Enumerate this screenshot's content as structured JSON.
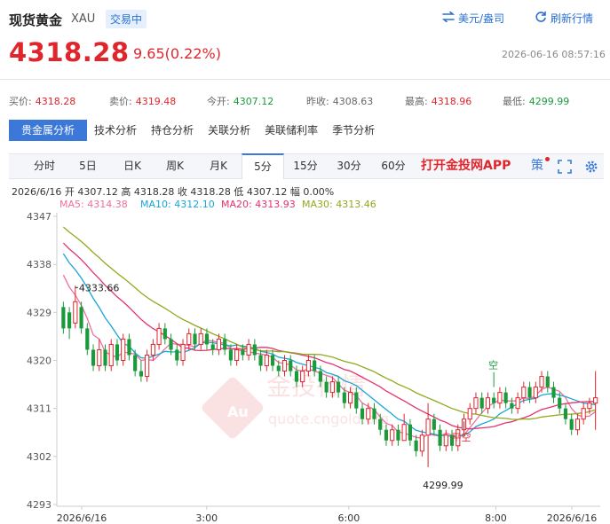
{
  "header": {
    "name": "现货黄金",
    "code": "XAU",
    "status_badge": "交易中",
    "currency_button": "美元/盎司",
    "refresh_button": "刷新行情"
  },
  "price": {
    "last": "4318.28",
    "change": "9.65(0.22%)",
    "datetime": "2026-06-16 08:57:16"
  },
  "quotes": [
    {
      "label": "买价:",
      "value": "4318.28"
    },
    {
      "label": "卖价:",
      "value": "4319.48"
    },
    {
      "label": "今开:",
      "value": "4307.12"
    },
    {
      "label": "昨收:",
      "value": "4308.63"
    },
    {
      "label": "最高:",
      "value": "4318.96"
    },
    {
      "label": "最低:",
      "value": "4299.99"
    }
  ],
  "analysis_tabs": [
    {
      "label": "贵金属分析",
      "active": true
    },
    {
      "label": "技术分析"
    },
    {
      "label": "持仓分析"
    },
    {
      "label": "关联分析"
    },
    {
      "label": "美联储利率"
    },
    {
      "label": "季节分析"
    }
  ],
  "period_tabs": [
    {
      "label": "分时"
    },
    {
      "label": "5日"
    },
    {
      "label": "日K"
    },
    {
      "label": "周K"
    },
    {
      "label": "月K"
    },
    {
      "label": "5分",
      "active": true
    },
    {
      "label": "15分"
    },
    {
      "label": "30分"
    },
    {
      "label": "60分"
    }
  ],
  "app_link": "打开金投网APP",
  "toolbar_icon_text": "策",
  "ohlc_line": "2026/6/16  开 4307.12  高 4318.28  收 4318.28  低 4307.12  幅 0.00%",
  "ma_legend": [
    {
      "label": "MA5: 4314.38",
      "color": "#f06fa0"
    },
    {
      "label": "MA10: 4312.10",
      "color": "#1aa5d6"
    },
    {
      "label": "MA20: 4313.93",
      "color": "#e5336b"
    },
    {
      "label": "MA30: 4313.46",
      "color": "#8faa1e"
    }
  ],
  "watermark": {
    "text": "金投行情",
    "sub": "quote.cngold.org"
  },
  "chart_data": {
    "type": "candlestick",
    "y_ticks": [
      "4347",
      "4338",
      "4329",
      "4320",
      "4311",
      "4302",
      "4293"
    ],
    "ylim": [
      4293,
      4347
    ],
    "x_ticks": [
      "2026/6/16",
      "3:00",
      "6:00",
      "8:00",
      "2026/6/16"
    ],
    "annotations": {
      "high": "4333.66",
      "low": "4299.99",
      "open_marker": "空",
      "close_marker": "平空"
    },
    "colors": {
      "up": "#e0262d",
      "down": "#1b9a3c"
    },
    "candles": [
      [
        4330,
        4326,
        4331,
        4325
      ],
      [
        4329,
        4326,
        4330,
        4324
      ],
      [
        4327,
        4331,
        4334,
        4326
      ],
      [
        4330,
        4326,
        4331,
        4325
      ],
      [
        4326,
        4322,
        4327,
        4321
      ],
      [
        4322,
        4319,
        4323,
        4318
      ],
      [
        4319,
        4322,
        4324,
        4318
      ],
      [
        4322,
        4319,
        4323,
        4318
      ],
      [
        4319,
        4323,
        4324,
        4318
      ],
      [
        4323,
        4320,
        4324,
        4319
      ],
      [
        4320,
        4324,
        4325,
        4319
      ],
      [
        4324,
        4321,
        4325,
        4320
      ],
      [
        4321,
        4318,
        4322,
        4317
      ],
      [
        4318,
        4317,
        4320,
        4316
      ],
      [
        4317,
        4321,
        4322,
        4316
      ],
      [
        4321,
        4323,
        4324,
        4320
      ],
      [
        4323,
        4326,
        4327,
        4322
      ],
      [
        4326,
        4324,
        4327,
        4323
      ],
      [
        4324,
        4322,
        4325,
        4321
      ],
      [
        4322,
        4320,
        4323,
        4319
      ],
      [
        4320,
        4323,
        4324,
        4319
      ],
      [
        4323,
        4325,
        4326,
        4322
      ],
      [
        4325,
        4323,
        4326,
        4322
      ],
      [
        4323,
        4325,
        4326,
        4322
      ],
      [
        4325,
        4323,
        4326,
        4322
      ],
      [
        4323,
        4322,
        4324,
        4321
      ],
      [
        4322,
        4324,
        4325,
        4321
      ],
      [
        4324,
        4322,
        4325,
        4321
      ],
      [
        4322,
        4320,
        4323,
        4319
      ],
      [
        4320,
        4322,
        4323,
        4319
      ],
      [
        4322,
        4321,
        4323,
        4320
      ],
      [
        4321,
        4323,
        4324,
        4320
      ],
      [
        4323,
        4321,
        4324,
        4320
      ],
      [
        4321,
        4319,
        4322,
        4318
      ],
      [
        4319,
        4321,
        4322,
        4318
      ],
      [
        4321,
        4319,
        4322,
        4318
      ],
      [
        4319,
        4318,
        4320,
        4317
      ],
      [
        4318,
        4320,
        4321,
        4317
      ],
      [
        4320,
        4318,
        4321,
        4317
      ],
      [
        4318,
        4316,
        4319,
        4315
      ],
      [
        4316,
        4318,
        4319,
        4315
      ],
      [
        4318,
        4320,
        4321,
        4317
      ],
      [
        4320,
        4318,
        4321,
        4317
      ],
      [
        4318,
        4316,
        4319,
        4315
      ],
      [
        4316,
        4314,
        4317,
        4313
      ],
      [
        4314,
        4316,
        4317,
        4313
      ],
      [
        4316,
        4314,
        4317,
        4313
      ],
      [
        4314,
        4312,
        4315,
        4311
      ],
      [
        4312,
        4314,
        4315,
        4311
      ],
      [
        4314,
        4311,
        4315,
        4310
      ],
      [
        4311,
        4309,
        4312,
        4308
      ],
      [
        4309,
        4311,
        4312,
        4308
      ],
      [
        4311,
        4309,
        4312,
        4308
      ],
      [
        4309,
        4307,
        4310,
        4306
      ],
      [
        4307,
        4305,
        4308,
        4304
      ],
      [
        4305,
        4307,
        4308,
        4304
      ],
      [
        4307,
        4305,
        4308,
        4304
      ],
      [
        4305,
        4308,
        4310,
        4305
      ],
      [
        4308,
        4305,
        4309,
        4304
      ],
      [
        4305,
        4303,
        4306,
        4302
      ],
      [
        4303,
        4306,
        4307,
        4302
      ],
      [
        4306,
        4309,
        4312,
        4300
      ],
      [
        4309,
        4307,
        4310,
        4306
      ],
      [
        4307,
        4304,
        4308,
        4303
      ],
      [
        4304,
        4306,
        4307,
        4303
      ],
      [
        4306,
        4304,
        4307,
        4303
      ],
      [
        4304,
        4307,
        4308,
        4303
      ],
      [
        4307,
        4309,
        4310,
        4306
      ],
      [
        4309,
        4311,
        4312,
        4308
      ],
      [
        4311,
        4313,
        4314,
        4310
      ],
      [
        4313,
        4311,
        4314,
        4310
      ],
      [
        4311,
        4313,
        4314,
        4310
      ],
      [
        4313,
        4312,
        4314,
        4311
      ],
      [
        4312,
        4314,
        4315,
        4311
      ],
      [
        4314,
        4312,
        4315,
        4311
      ],
      [
        4312,
        4311,
        4313,
        4310
      ],
      [
        4311,
        4313,
        4314,
        4310
      ],
      [
        4313,
        4315,
        4316,
        4312
      ],
      [
        4315,
        4313,
        4316,
        4312
      ],
      [
        4313,
        4315,
        4316,
        4312
      ],
      [
        4315,
        4317,
        4318,
        4314
      ],
      [
        4317,
        4315,
        4318,
        4314
      ],
      [
        4315,
        4313,
        4316,
        4312
      ],
      [
        4313,
        4311,
        4314,
        4310
      ],
      [
        4311,
        4309,
        4312,
        4308
      ],
      [
        4309,
        4307,
        4310,
        4306
      ],
      [
        4307,
        4309,
        4310,
        4306
      ],
      [
        4309,
        4311,
        4312,
        4308
      ],
      [
        4311,
        4312,
        4313,
        4310
      ],
      [
        4312,
        4313,
        4318,
        4307
      ]
    ]
  }
}
